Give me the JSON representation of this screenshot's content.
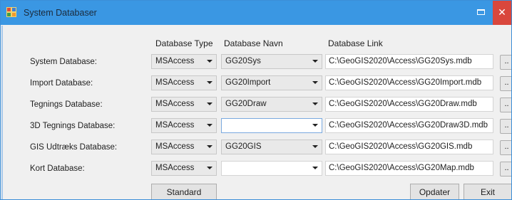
{
  "window": {
    "title": "System Databaser",
    "icon": "app-window-icon",
    "close_label": "✕"
  },
  "headers": {
    "type": "Database Type",
    "name": "Database Navn",
    "link": "Database Link"
  },
  "rows": [
    {
      "label": "System Database:",
      "type": "MSAccess",
      "name": "GG20Sys",
      "link": "C:\\GeoGIS2020\\Access\\GG20Sys.mdb",
      "browse": ".."
    },
    {
      "label": "Import Database:",
      "type": "MSAccess",
      "name": "GG20Import",
      "link": "C:\\GeoGIS2020\\Access\\GG20Import.mdb",
      "browse": ".."
    },
    {
      "label": "Tegnings Database:",
      "type": "MSAccess",
      "name": "GG20Draw",
      "link": "C:\\GeoGIS2020\\Access\\GG20Draw.mdb",
      "browse": ".."
    },
    {
      "label": "3D Tegnings Database:",
      "type": "MSAccess",
      "name": "",
      "link": "C:\\GeoGIS2020\\Access\\GG20Draw3D.mdb",
      "browse": ".."
    },
    {
      "label": "GIS Udtræks Database:",
      "type": "MSAccess",
      "name": "GG20GIS",
      "link": "C:\\GeoGIS2020\\Access\\GG20GIS.mdb",
      "browse": ".."
    },
    {
      "label": "Kort Database:",
      "type": "MSAccess",
      "name": "",
      "link": "C:\\GeoGIS2020\\Access\\GG20Map.mdb",
      "browse": ".."
    }
  ],
  "buttons": {
    "standard": "Standard",
    "opdater": "Opdater",
    "exit": "Exit"
  },
  "colors": {
    "titlebar": "#3a97e3",
    "close": "#d9473c",
    "background": "#f0f0f0"
  }
}
